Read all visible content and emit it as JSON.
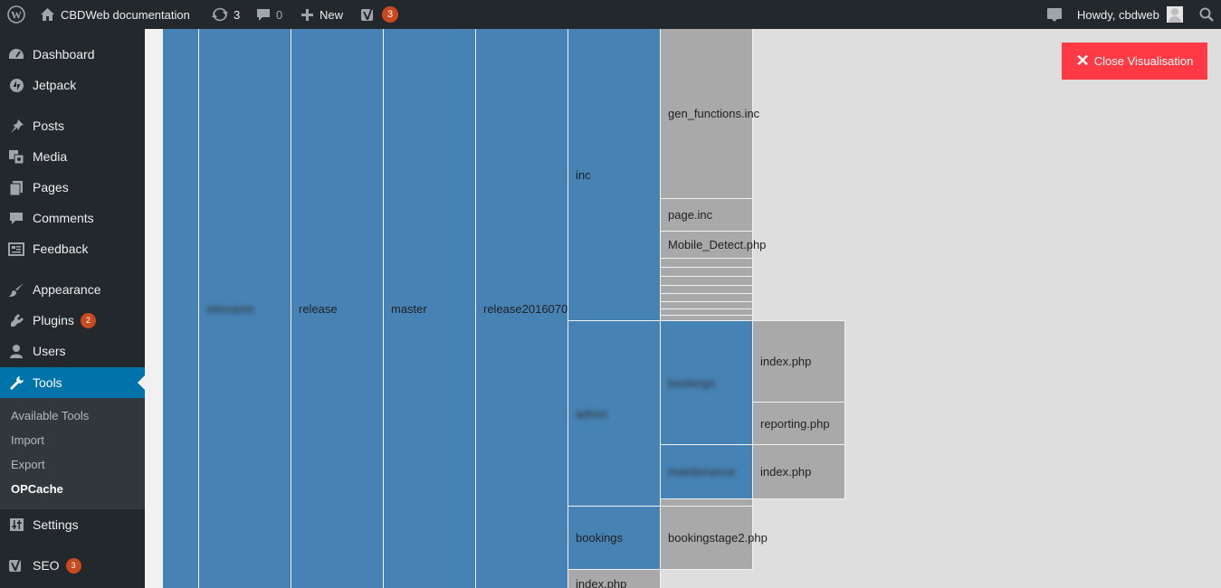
{
  "adminbar": {
    "site_name": "CBDWeb documentation",
    "updates_count": "3",
    "comments_count": "0",
    "new_label": "New",
    "seo_badge": "3",
    "howdy": "Howdy, cbdweb"
  },
  "sidebar": {
    "items": [
      {
        "label": "Dashboard",
        "icon": "dashboard-icon"
      },
      {
        "label": "Jetpack",
        "icon": "jetpack-icon"
      },
      {
        "label": "Posts",
        "icon": "pin-icon"
      },
      {
        "label": "Media",
        "icon": "media-icon"
      },
      {
        "label": "Pages",
        "icon": "pages-icon"
      },
      {
        "label": "Comments",
        "icon": "comment-icon"
      },
      {
        "label": "Feedback",
        "icon": "feedback-icon"
      },
      {
        "label": "Appearance",
        "icon": "brush-icon"
      },
      {
        "label": "Plugins",
        "icon": "plugin-icon",
        "badge": "2"
      },
      {
        "label": "Users",
        "icon": "user-icon"
      },
      {
        "label": "Tools",
        "icon": "wrench-icon"
      },
      {
        "label": "Settings",
        "icon": "sliders-icon"
      },
      {
        "label": "SEO",
        "icon": "yoast-icon",
        "badge": "3"
      }
    ],
    "submenu": [
      "Available Tools",
      "Import",
      "Export",
      "OPCache"
    ]
  },
  "visualisation": {
    "close_label": "Close Visualisation",
    "cells": {
      "c1": "sitename",
      "c2": "release",
      "c3": "master",
      "c4": "release2016070",
      "inc": "inc",
      "gen": "gen_functions.inc",
      "page": "page.inc",
      "mobile": "Mobile_Detect.php",
      "admin": "admin",
      "bookings_blur": "bookings",
      "idx1": "index.php",
      "reporting": "reporting.php",
      "maint": "maintenance",
      "idx2": "index.php",
      "bookings": "bookings",
      "bstage": "bookingstage2.php",
      "idx3": "index.php"
    }
  }
}
